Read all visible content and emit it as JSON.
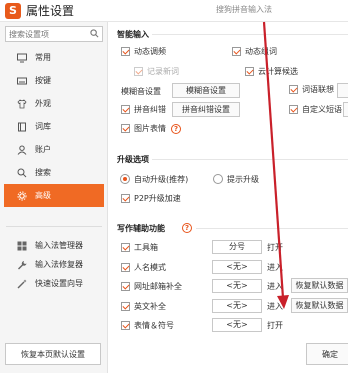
{
  "window": {
    "title": "属性设置",
    "logo_text": "S",
    "subtitle": "搜狗拼音输入法"
  },
  "sidebar": {
    "search_placeholder": "搜索设置项",
    "items": [
      {
        "label": "常用",
        "icon": "monitor-icon"
      },
      {
        "label": "按键",
        "icon": "keyboard-icon"
      },
      {
        "label": "外观",
        "icon": "shirt-icon"
      },
      {
        "label": "词库",
        "icon": "book-icon"
      },
      {
        "label": "账户",
        "icon": "user-icon"
      },
      {
        "label": "搜索",
        "icon": "search-icon"
      },
      {
        "label": "高级",
        "icon": "gear-icon",
        "active": true
      }
    ],
    "tools": [
      {
        "label": "输入法管理器",
        "icon": "grid-icon"
      },
      {
        "label": "输入法修复器",
        "icon": "wrench-icon"
      },
      {
        "label": "快速设置向导",
        "icon": "wand-icon"
      }
    ],
    "restore_label": "恢复本页默认设置"
  },
  "smart_input": {
    "title": "智能输入",
    "dynamic_tune": "动态调频",
    "dynamic_group": "动态组词",
    "record_new_words": "记录新词",
    "cloud_candidates": "云计算候选",
    "fuzzy": "模糊音设置",
    "fuzzy_button": "模糊音设置",
    "word_assoc": "词语联想",
    "pinyin_correct": "拼音纠错",
    "pinyin_correct_button": "拼音纠错设置",
    "custom_phrase": "自定义短语",
    "image_emoji": "图片表情"
  },
  "upgrade": {
    "title": "升级选项",
    "auto": "自动升级(推荐)",
    "prompt": "提示升级",
    "p2p": "P2P升级加速"
  },
  "writing": {
    "title": "写作辅助功能",
    "rows": [
      {
        "label": "工具箱",
        "key": "分号",
        "action": "打开"
      },
      {
        "label": "人名模式",
        "key": "<无>",
        "action": "进入"
      },
      {
        "label": "网址邮箱补全",
        "key": "<无>",
        "action": "进入"
      },
      {
        "label": "英文补全",
        "key": "<无>",
        "action": "进入"
      },
      {
        "label": "表情＆符号",
        "key": "<无>",
        "action": "打开"
      }
    ],
    "restore_default_button": "恢复默认数据"
  },
  "footer": {
    "ok_label": "确定"
  },
  "colors": {
    "accent": "#f06a24",
    "arrow": "#c9202a"
  }
}
